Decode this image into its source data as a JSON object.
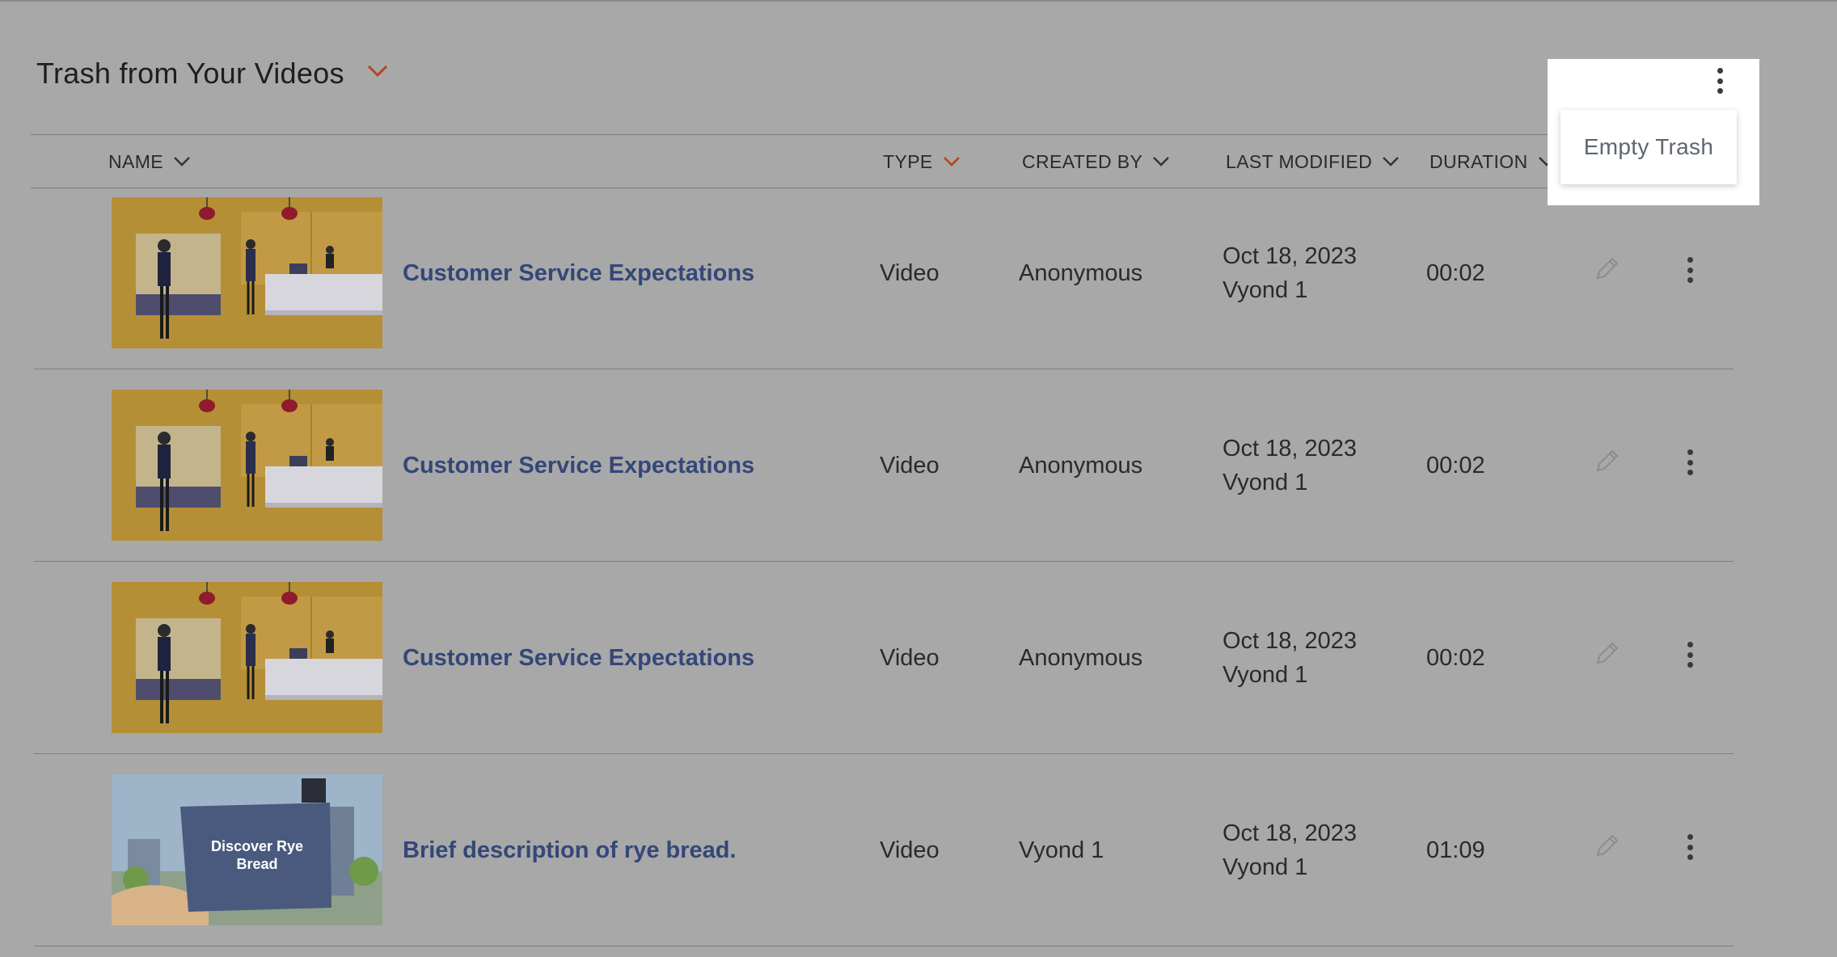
{
  "page": {
    "title": "Trash from Your Videos"
  },
  "columns": {
    "name": "NAME",
    "type": "TYPE",
    "created_by": "CREATED BY",
    "last_modified": "LAST MODIFIED",
    "duration": "DURATION"
  },
  "rows": [
    {
      "name": "Customer Service Expectations",
      "type": "Video",
      "created_by": "Anonymous",
      "modified_date": "Oct 18, 2023",
      "modified_by": "Vyond 1",
      "duration": "00:02",
      "thumbnail": "bakery-scene"
    },
    {
      "name": "Customer Service Expectations",
      "type": "Video",
      "created_by": "Anonymous",
      "modified_date": "Oct 18, 2023",
      "modified_by": "Vyond 1",
      "duration": "00:02",
      "thumbnail": "bakery-scene"
    },
    {
      "name": "Customer Service Expectations",
      "type": "Video",
      "created_by": "Anonymous",
      "modified_date": "Oct 18, 2023",
      "modified_by": "Vyond 1",
      "duration": "00:02",
      "thumbnail": "bakery-scene"
    },
    {
      "name": "Brief description of rye bread.",
      "type": "Video",
      "created_by": "Vyond 1",
      "modified_date": "Oct 18, 2023",
      "modified_by": "Vyond 1",
      "duration": "01:09",
      "thumbnail": "rye-card-scene",
      "thumbnail_text": "Discover Rye Bread"
    }
  ],
  "menu": {
    "items": [
      "Empty Trash"
    ]
  },
  "colors": {
    "overlay": "#a8a8a8",
    "link": "#34477a",
    "accent_chevron": "#b5451b",
    "menu_bg": "#ffffff"
  }
}
